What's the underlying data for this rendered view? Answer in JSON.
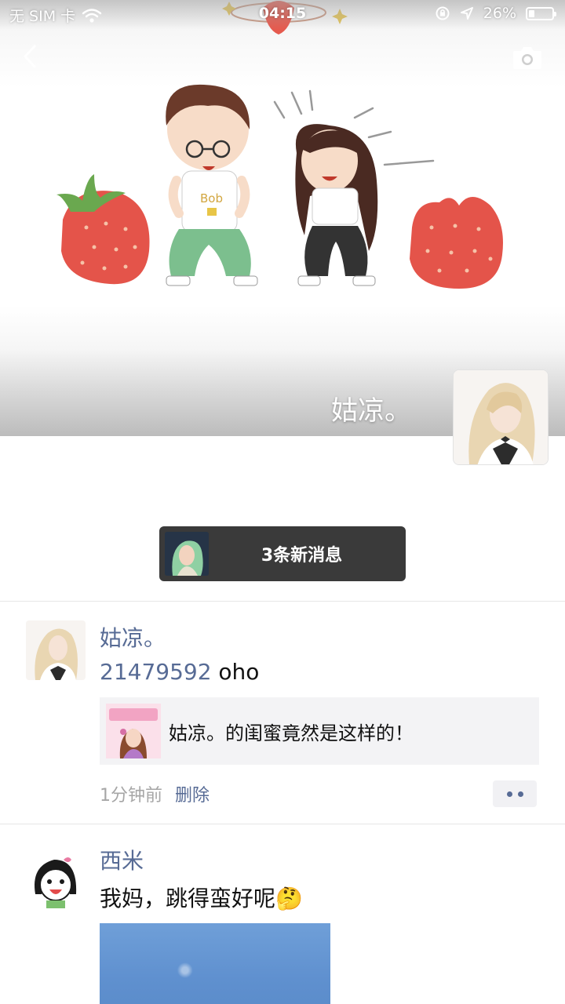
{
  "status_bar": {
    "carrier": "无 SIM 卡",
    "time": "04:15",
    "battery": "26%",
    "battery_level": 0.26
  },
  "icons": {
    "back": "back-chevron-icon",
    "camera": "camera-icon",
    "wifi": "wifi-icon",
    "lock_rotation": "orientation-lock-icon",
    "location": "location-arrow-icon",
    "battery": "battery-icon"
  },
  "profile": {
    "name": "姑凉。"
  },
  "new_messages": {
    "label": "3条新消息"
  },
  "posts": [
    {
      "author": "姑凉。",
      "mention": "21479592",
      "text": " oho",
      "share": {
        "title": "姑凉。的闺蜜竟然是这样的！"
      },
      "time": "1分钟前",
      "delete_label": "删除"
    },
    {
      "author": "西米",
      "text": "我妈，跳得蛮好呢",
      "emoji": "🤔"
    }
  ],
  "colors": {
    "link_blue": "#576b95",
    "pill_bg": "#3a3a3a",
    "meta_gray": "#a6a6a6"
  }
}
